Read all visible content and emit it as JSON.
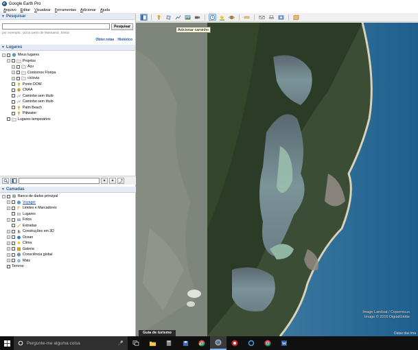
{
  "window": {
    "title": "Google Earth Pro"
  },
  "menu": [
    "Arquivo",
    "Editar",
    "Visualizar",
    "Ferramentas",
    "Adicionar",
    "Ajuda"
  ],
  "toolbar": {
    "icons": [
      "sidebar-toggle-icon",
      "placemark-icon",
      "polygon-icon",
      "path-icon",
      "image-overlay-icon",
      "record-tour-icon",
      "historical-imagery-icon",
      "sun-icon",
      "planets-icon",
      "ruler-icon",
      "email-icon",
      "print-icon",
      "save-image-icon",
      "maps-icon"
    ],
    "tooltip": "Adicionar caminho"
  },
  "search": {
    "header": "Pesquisar",
    "button": "Pesquisar",
    "placeholder": "",
    "hint": "por exemplo,: pizza perto de Massamá, Sintra",
    "links": [
      "Obter rotas",
      "Histórico"
    ]
  },
  "places": {
    "header": "Lugares",
    "items": [
      {
        "label": "Meus lugares",
        "indent": 0,
        "expand": "−",
        "icon": "globe-icon"
      },
      {
        "label": "Projetos",
        "indent": 1,
        "expand": "−",
        "icon": "folder-icon"
      },
      {
        "label": "Açu",
        "indent": 2,
        "expand": "+",
        "icon": "folder-icon"
      },
      {
        "label": "Contornos Floripa",
        "indent": 2,
        "expand": "+",
        "icon": "folder-icon"
      },
      {
        "label": "ciclovia",
        "indent": 2,
        "expand": "+",
        "icon": "folder-icon"
      },
      {
        "label": "Ponto DOW",
        "indent": 1,
        "expand": "",
        "icon": "pin-icon"
      },
      {
        "label": "CNAA",
        "indent": 1,
        "expand": "",
        "icon": "circle-icon"
      },
      {
        "label": "Caminho sem título",
        "indent": 1,
        "expand": "",
        "icon": "path-icon"
      },
      {
        "label": "Caminho sem título",
        "indent": 1,
        "expand": "",
        "icon": "path-icon"
      },
      {
        "label": "Palm Beach",
        "indent": 1,
        "expand": "",
        "icon": "pin-icon"
      },
      {
        "label": "Pittwater",
        "indent": 1,
        "expand": "",
        "icon": "pin-icon"
      },
      {
        "label": "Lugares temporários",
        "indent": 0,
        "expand": "",
        "icon": "folder-icon"
      }
    ]
  },
  "layers": {
    "header": "Camadas",
    "items": [
      {
        "label": "Banco de dados principal",
        "indent": 0,
        "expand": "−",
        "icon": "db-icon",
        "link": false
      },
      {
        "label": "Voyager",
        "indent": 1,
        "expand": "+",
        "icon": "voyager-icon",
        "link": true
      },
      {
        "label": "Limites e Marcadores",
        "indent": 1,
        "expand": "+",
        "icon": "flag-icon",
        "link": false
      },
      {
        "label": "Lugares",
        "indent": 1,
        "expand": "",
        "icon": "places-icon",
        "link": false
      },
      {
        "label": "Fotos",
        "indent": 1,
        "expand": "+",
        "icon": "photo-icon",
        "link": false
      },
      {
        "label": "Estradas",
        "indent": 1,
        "expand": "",
        "icon": "road-icon",
        "link": false
      },
      {
        "label": "Construções em 3D",
        "indent": 1,
        "expand": "+",
        "icon": "building-icon",
        "link": false
      },
      {
        "label": "Ocean",
        "indent": 1,
        "expand": "+",
        "icon": "ocean-icon",
        "link": false
      },
      {
        "label": "Clima",
        "indent": 1,
        "expand": "+",
        "icon": "weather-icon",
        "link": false
      },
      {
        "label": "Galeria",
        "indent": 1,
        "expand": "+",
        "icon": "gallery-icon",
        "link": false
      },
      {
        "label": "Consciência global",
        "indent": 1,
        "expand": "+",
        "icon": "globe-icon",
        "link": false
      },
      {
        "label": "Mais",
        "indent": 1,
        "expand": "+",
        "icon": "more-icon",
        "link": false
      },
      {
        "label": "Terreno",
        "indent": 0,
        "expand": "",
        "icon": "",
        "link": false
      }
    ]
  },
  "map": {
    "attribution": [
      "Image Landsat / Copernicus",
      "Image © 2016 DigitalGlobe"
    ],
    "guide_tab": "Guia de turismo",
    "status": "Datas das ima"
  },
  "taskbar": {
    "search_placeholder": "Pergunte-me alguma coisa",
    "apps": [
      "task-view-icon",
      "file-explorer-icon",
      "calculator-icon",
      "floppy-icon",
      "chrome-icon",
      "google-earth-icon",
      "app-red-icon",
      "app-refresh-icon",
      "chrome-alt-icon",
      "word-icon"
    ]
  },
  "colors": {
    "accent": "#2e5c8a",
    "link": "#1a4e9c",
    "panel_header_bg": "#e4ebf4"
  }
}
